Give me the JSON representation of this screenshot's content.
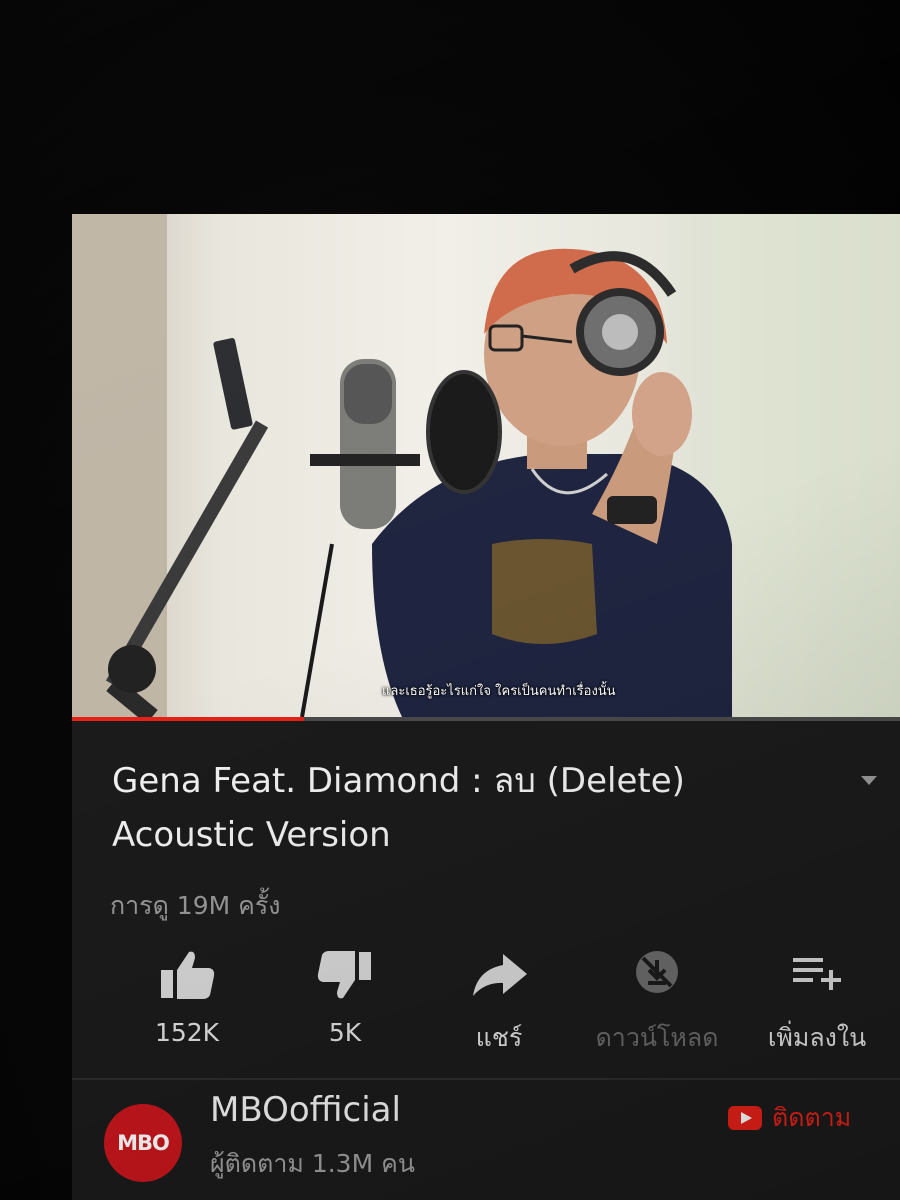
{
  "video": {
    "subtitle": "และเธอรู้อะไรแก่ใจ ใครเป็นคนทำเรื่องนั้น",
    "progress": 0.28
  },
  "title": "Gena Feat. Diamond : ลบ (Delete) Acoustic Version",
  "views": "การดู 19M ครั้ง",
  "actions": {
    "like": {
      "label": "152K",
      "icon": "thumbs-up-icon"
    },
    "dislike": {
      "label": "5K",
      "icon": "thumbs-down-icon"
    },
    "share": {
      "label": "แชร์",
      "icon": "share-arrow-icon"
    },
    "download": {
      "label": "ดาวน์โหลด",
      "icon": "download-disabled-icon"
    },
    "save": {
      "label": "เพิ่มลงใน",
      "icon": "playlist-add-icon"
    }
  },
  "channel": {
    "avatar_text": "MBO",
    "name": "MBOofficial",
    "subscribers": "ผู้ติดตาม 1.3M คน",
    "subscribe_label": "ติดตาม"
  },
  "colors": {
    "accent": "#e62117",
    "background": "#1b1b1b",
    "text_primary": "#f2f2f2",
    "text_secondary": "#9a9a9a",
    "disabled": "#6b6b6b"
  }
}
